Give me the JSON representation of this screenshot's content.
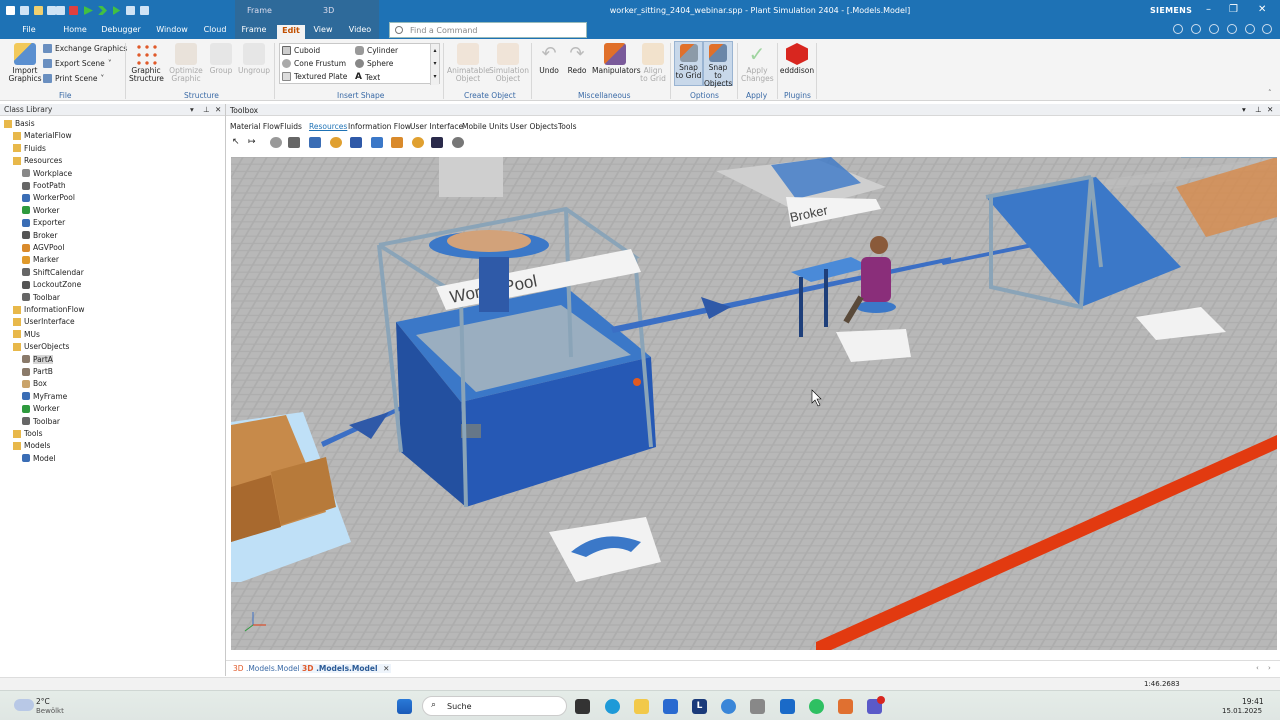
{
  "window": {
    "title": "worker_sitting_2404_webinar.spp - Plant Simulation 2404 - [.Models.Model]",
    "brand": "SIEMENS"
  },
  "context_tabs": {
    "group1": "Frame",
    "group2": "3D"
  },
  "tabs": [
    "File",
    "Home",
    "Debugger",
    "Window",
    "Cloud",
    "Frame",
    "Edit",
    "View",
    "Video"
  ],
  "search": {
    "placeholder": "Find a Command"
  },
  "ribbon": {
    "file": {
      "import": "Import Graphics",
      "exchange": "Exchange Graphics",
      "export": "Export Scene",
      "print": "Print Scene",
      "label": "File"
    },
    "structure": {
      "graphic_structure": "Graphic Structure",
      "optimize": "Optimize Graphic",
      "group": "Group",
      "ungroup": "Ungroup",
      "label": "Structure"
    },
    "insert": {
      "cuboid": "Cuboid",
      "cone": "Cone Frustum",
      "textured": "Textured Plate",
      "cylinder": "Cylinder",
      "sphere": "Sphere",
      "text": "Text",
      "label": "Insert Shape"
    },
    "create": {
      "animatable": "Animatable Object",
      "simulation": "Simulation Object",
      "label": "Create Object"
    },
    "misc": {
      "undo": "Undo",
      "redo": "Redo",
      "manipulators": "Manipulators",
      "align": "Align to Grid",
      "label": "Miscellaneous"
    },
    "options": {
      "snap_grid": "Snap to Grid",
      "snap_objects": "Snap to Objects",
      "label": "Options"
    },
    "apply": {
      "apply_changes": "Apply Changes",
      "label": "Apply"
    },
    "plugins": {
      "edddison": "edddison",
      "label": "Plugins"
    }
  },
  "class_library": {
    "title": "Class Library",
    "items": [
      {
        "label": "Basis",
        "color": "#e8b84a"
      },
      {
        "label": "MaterialFlow",
        "color": "#e8b84a"
      },
      {
        "label": "Fluids",
        "color": "#e8b84a"
      },
      {
        "label": "Resources",
        "color": "#e8b84a"
      },
      {
        "label": "Workplace",
        "color": "#888888"
      },
      {
        "label": "FootPath",
        "color": "#666666"
      },
      {
        "label": "WorkerPool",
        "color": "#3a6db5"
      },
      {
        "label": "Worker",
        "color": "#2e9a3e"
      },
      {
        "label": "Exporter",
        "color": "#3a6db5"
      },
      {
        "label": "Broker",
        "color": "#555555"
      },
      {
        "label": "AGVPool",
        "color": "#d98a2b"
      },
      {
        "label": "Marker",
        "color": "#e09a2b"
      },
      {
        "label": "ShiftCalendar",
        "color": "#666666"
      },
      {
        "label": "LockoutZone",
        "color": "#555555"
      },
      {
        "label": "Toolbar",
        "color": "#666666"
      },
      {
        "label": "InformationFlow",
        "color": "#e8b84a"
      },
      {
        "label": "UserInterface",
        "color": "#e8b84a"
      },
      {
        "label": "MUs",
        "color": "#e8b84a"
      },
      {
        "label": "UserObjects",
        "color": "#e8b84a"
      },
      {
        "label": "PartA",
        "color": "#8a7a6a"
      },
      {
        "label": "PartB",
        "color": "#8a7a6a"
      },
      {
        "label": "Box",
        "color": "#c9a36a"
      },
      {
        "label": "MyFrame",
        "color": "#3a6db5"
      },
      {
        "label": "Worker",
        "color": "#2e9a3e"
      },
      {
        "label": "Toolbar",
        "color": "#666666"
      },
      {
        "label": "Tools",
        "color": "#e8b84a"
      },
      {
        "label": "Models",
        "color": "#e8b84a"
      },
      {
        "label": "Model",
        "color": "#3a6db5"
      }
    ]
  },
  "toolbox": {
    "title": "Toolbox",
    "tabs": [
      "Material Flow",
      "Fluids",
      "Resources",
      "Information Flow",
      "User Interface",
      "Mobile Units",
      "User Objects",
      "Tools"
    ]
  },
  "scene": {
    "label_workerpool": "WorkerPool",
    "label_broker": "Broker"
  },
  "doc_tabs": [
    {
      "prefix": "3D",
      "name": ".Models.Model"
    },
    {
      "prefix": "3D",
      "name": ".Models.Model"
    }
  ],
  "status": {
    "time": "1:46.2683"
  },
  "taskbar": {
    "weather_temp": "2°C",
    "weather_desc": "Bewölkt",
    "search": "Suche",
    "clock_time": "19:41",
    "clock_date": "15.01.2025"
  }
}
